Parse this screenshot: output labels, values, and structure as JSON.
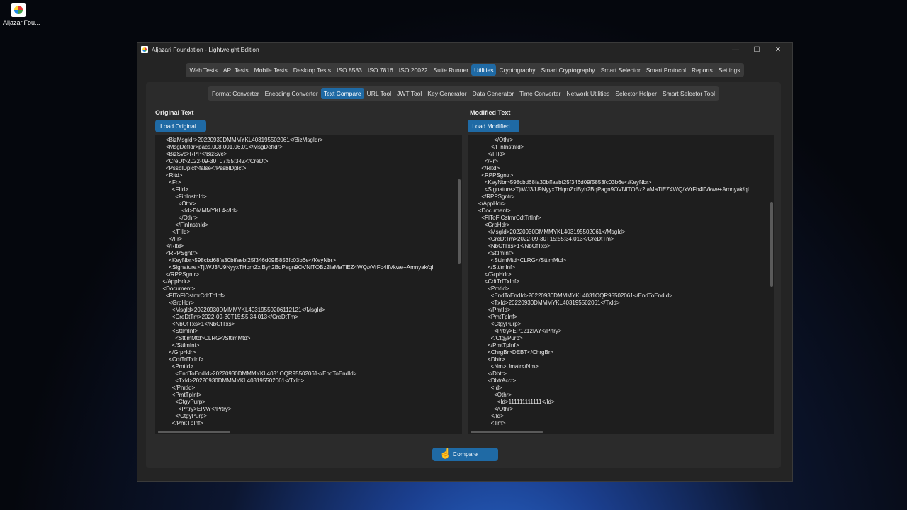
{
  "desktop": {
    "icon_label": "AljazariFou..."
  },
  "window": {
    "title": "Aljazari Foundation - Lightweight Edition",
    "controls": {
      "minimize": "—",
      "maximize": "☐",
      "close": "✕"
    }
  },
  "main_tabs": [
    "Web Tests",
    "API Tests",
    "Mobile Tests",
    "Desktop Tests",
    "ISO 8583",
    "ISO 7816",
    "ISO 20022",
    "Suite Runner",
    "Utilities",
    "Cryptography",
    "Smart Cryptography",
    "Smart Selector",
    "Smart Protocol",
    "Reports",
    "Settings"
  ],
  "main_tabs_active": "Utilities",
  "sub_tabs": [
    "Format Converter",
    "Encoding Converter",
    "Text Compare",
    "URL Tool",
    "JWT Tool",
    "Key Generator",
    "Data Generator",
    "Time Converter",
    "Network Utilities",
    "Selector Helper",
    "Smart Selector Tool"
  ],
  "sub_tabs_active": "Text Compare",
  "original": {
    "label": "Original Text",
    "load_button": "Load Original...",
    "text": "    <BizMsgIdr>20220930DMMMYKL403195502061</BizMsgIdr>\n    <MsgDefIdr>pacs.008.001.06.01</MsgDefIdr>\n    <BizSvc>RPP</BizSvc>\n    <CreDt>2022-09-30T07:55:34Z</CreDt>\n    <PssblDplct>false</PssblDplct>\n    <Rltd>\n      <Fr>\n        <FIId>\n          <FinInstnId>\n            <Othr>\n              <Id>DMMMYKL4</Id>\n            </Othr>\n          </FinInstnId>\n        </FIId>\n      </Fr>\n    </Rltd>\n    <RPPSgntr>\n      <KeyNbr>598cbd68fa30bffaebf25f346d09f5853fc03b6e</KeyNbr>\n      <Signature>TjtWJ3/U9NyyxTHqmZxlByh2BqPagn9OVNfTOBz2IaMaTlEZ4WQ/xVrFb4lfVkwe+Amnyak/qI\n    </RPPSgntr>\n  </AppHdr>\n  <Document>\n    <FIToFICstmrCdtTrfInf>\n      <GrpHdr>\n        <MsgId>20220930DMMMYKL40319550206112121</MsgId>\n        <CreDtTm>2022-09-30T15:55:34.013</CreDtTm>\n        <NbOfTxs>1</NbOfTxs>\n        <SttlmInf>\n          <SttlmMtd>CLRG</SttlmMtd>\n        </SttlmInf>\n      </GrpHdr>\n      <CdtTrfTxInf>\n        <PmtId>\n          <EndToEndId>20220930DMMMYKL4031OQR95502061</EndToEndId>\n          <TxId>20220930DMMMYKL403195502061</TxId>\n        </PmtId>\n        <PmtTpInf>\n          <CtgyPurp>\n            <Prtry>EPAY</Prtry>\n          </CtgyPurp>\n        </PmtTpInf>"
  },
  "modified": {
    "label": "Modified Text",
    "load_button": "Load Modified...",
    "text": "              </Othr>\n            </FinInstnId>\n          </FIId>\n        </Fr>\n      </Rltd>\n      <RPPSgntr>\n        <KeyNbr>598cbd68fa30bffaebf25f346d09f5853fc03b6e</KeyNbr>\n        <Signature>TjtWJ3/U9NyyxTHqmZxlByh2BqPagn9OVNfTOBz2IaMaTlEZ4WQ/xVrFb4lfVkwe+Amnyak/qI\n      </RPPSgntr>\n    </AppHdr>\n    <Document>\n      <FIToFICstmrCdtTrfInf>\n        <GrpHdr>\n          <MsgId>20220930DMMMYKL403195502061</MsgId>\n          <CreDtTm>2022-09-30T15:55:34.013</CreDtTm>\n          <NbOfTxs>1</NbOfTxs>\n          <SttlmInf>\n            <SttlmMtd>CLRG</SttlmMtd>\n          </SttlmInf>\n        </GrpHdr>\n        <CdtTrfTxInf>\n          <PmtId>\n            <EndToEndId>20220930DMMMYKL4031OQR95502061</EndToEndId>\n            <TxId>20220930DMMMYKL403195502061</TxId>\n          </PmtId>\n          <PmtTpInf>\n            <CtgyPurp>\n              <Prtry>EP1212IAY</Prtry>\n            </CtgyPurp>\n          </PmtTpInf>\n          <ChrgBr>DEBT</ChrgBr>\n          <Dbtr>\n            <Nm>Umair</Nm>\n          </Dbtr>\n          <DbtrAcct>\n            <Id>\n              <Othr>\n                <Id>111111111111</Id>\n              </Othr>\n            </Id>\n            <Tm>"
  },
  "compare_button": "Compare"
}
